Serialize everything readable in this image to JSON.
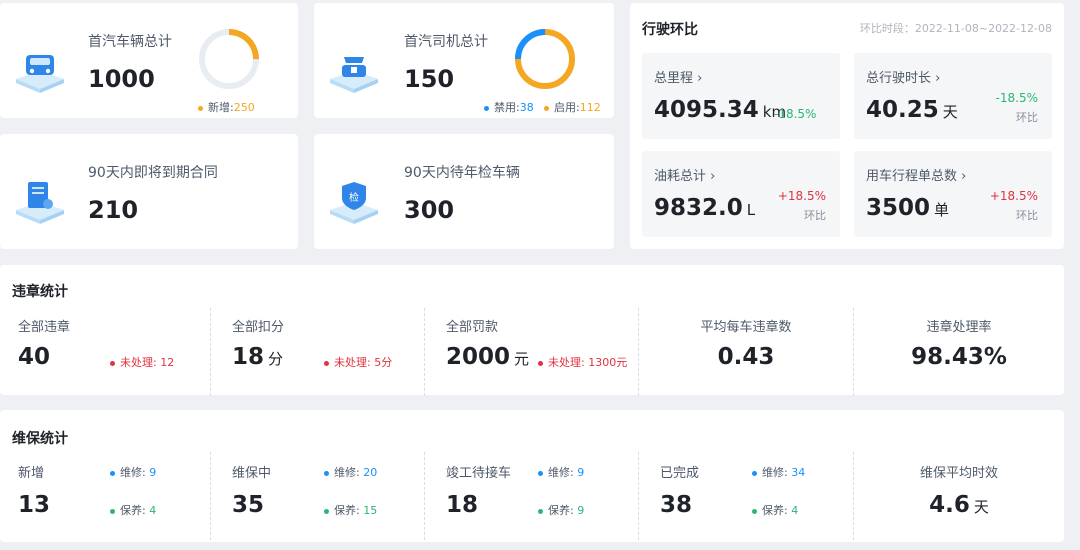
{
  "colors": {
    "orange": "#f5a623",
    "blue": "#1890ff",
    "red": "#e0333f",
    "green": "#2bb673",
    "ring_bg": "#e8edf3"
  },
  "cards": {
    "vehicles": {
      "title": "首汽车辆总计",
      "value": "1000",
      "legend_label": "新增:",
      "legend_value": "250",
      "ring_fraction": 0.25
    },
    "drivers": {
      "title": "首汽司机总计",
      "value": "150",
      "disabled_label": "禁用:",
      "disabled_value": "38",
      "enabled_label": "启用:",
      "enabled_value": "112",
      "ring_fraction_disabled": 0.25
    },
    "contracts": {
      "title": "90天内即将到期合同",
      "value": "210"
    },
    "inspection": {
      "title": "90天内待年检车辆",
      "value": "300",
      "icon_char": "检"
    }
  },
  "trend": {
    "title": "行驶环比",
    "period": "环比时段：2022-11-08~2022-12-08",
    "items": [
      {
        "label": "总里程",
        "value": "4095.34",
        "unit": "km",
        "pct": "-18.5%",
        "sub": ""
      },
      {
        "label": "总行驶时长",
        "value": "40.25",
        "unit": "天",
        "pct": "-18.5%",
        "sub": "环比"
      },
      {
        "label": "油耗总计",
        "value": "9832.0",
        "unit": "L",
        "pct": "+18.5%",
        "sub": "环比"
      },
      {
        "label": "用车行程单总数",
        "value": "3500",
        "unit": "单",
        "pct": "+18.5%",
        "sub": "环比"
      }
    ]
  },
  "violations": {
    "title": "违章统计",
    "cols": [
      {
        "label": "全部违章",
        "value": "40",
        "unit": "",
        "pending": "未处理: 12"
      },
      {
        "label": "全部扣分",
        "value": "18",
        "unit": "分",
        "pending": "未处理: 5分"
      },
      {
        "label": "全部罚款",
        "value": "2000",
        "unit": "元",
        "pending": "未处理: 1300元"
      },
      {
        "label": "平均每车违章数",
        "value": "0.43"
      },
      {
        "label": "违章处理率",
        "value": "98.43%"
      }
    ]
  },
  "maintenance": {
    "title": "维保统计",
    "repair_label": "维修:",
    "service_label": "保养:",
    "cols": [
      {
        "label": "新增",
        "value": "13",
        "repair": "9",
        "service": "4"
      },
      {
        "label": "维保中",
        "value": "35",
        "repair": "20",
        "service": "15"
      },
      {
        "label": "竣工待接车",
        "value": "18",
        "repair": "9",
        "service": "9"
      },
      {
        "label": "已完成",
        "value": "38",
        "repair": "34",
        "service": "4"
      },
      {
        "label": "维保平均时效",
        "value": "4.6",
        "unit": "天"
      }
    ]
  }
}
